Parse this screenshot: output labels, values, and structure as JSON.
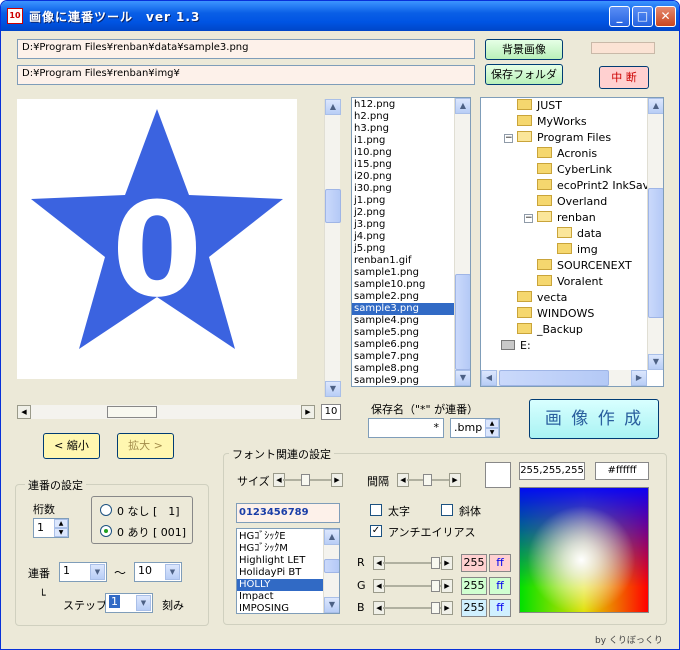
{
  "window": {
    "title": "画像に連番ツール　ver 1.3",
    "icon": "app-icon"
  },
  "paths": {
    "image_path": "D:¥Program Files¥renban¥data¥sample3.png",
    "save_folder": "D:¥Program Files¥renban¥img¥"
  },
  "buttons": {
    "bg_image": "背景画像",
    "save_folder": "保存フォルダ",
    "stop": "中 断",
    "zoom_out": "< 縮小",
    "zoom_in": "拡大 >",
    "create": "画 像 作 成"
  },
  "preview": {
    "digit": "0",
    "zoom_value": "10"
  },
  "file_list": {
    "items": [
      "h12.png",
      "h2.png",
      "h3.png",
      "i1.png",
      "i10.png",
      "i15.png",
      "i20.png",
      "i30.png",
      "j1.png",
      "j2.png",
      "j3.png",
      "j4.png",
      "j5.png",
      "renban1.gif",
      "sample1.png",
      "sample10.png",
      "sample2.png",
      "sample3.png",
      "sample4.png",
      "sample5.png",
      "sample6.png",
      "sample7.png",
      "sample8.png",
      "sample9.png"
    ],
    "selected": "sample3.png"
  },
  "tree": {
    "items": [
      {
        "label": "JUST",
        "level": 1
      },
      {
        "label": "MyWorks",
        "level": 1
      },
      {
        "label": "Program Files",
        "level": 1
      },
      {
        "label": "Acronis",
        "level": 2
      },
      {
        "label": "CyberLink",
        "level": 2
      },
      {
        "label": "ecoPrint2 InkSave",
        "level": 2
      },
      {
        "label": "Overland",
        "level": 2
      },
      {
        "label": "renban",
        "level": 2
      },
      {
        "label": "data",
        "level": 3
      },
      {
        "label": "img",
        "level": 3
      },
      {
        "label": "SOURCENEXT",
        "level": 2
      },
      {
        "label": "Voralent",
        "level": 2
      },
      {
        "label": "vecta",
        "level": 1
      },
      {
        "label": "WINDOWS",
        "level": 1
      },
      {
        "label": "_Backup",
        "level": 1
      },
      {
        "label": "E:",
        "level": 0
      }
    ]
  },
  "save_name": {
    "label": "保存名（\"*\" が連番）",
    "value": "*",
    "ext": ".bmp"
  },
  "serial": {
    "group_title": "連番の設定",
    "digits_label": "桁数",
    "digits_value": "1",
    "radio_none": "0 なし [　1]",
    "radio_pad": "0 あり [ 001]",
    "serial_label": "連番",
    "from_value": "1",
    "tilde": "〜",
    "to_value": "10",
    "step_prefix": "└",
    "step_label": "ステップ",
    "step_value": "1",
    "step_unit": "刻み"
  },
  "font": {
    "group_title": "フォント関連の設定",
    "size_label": "サイズ",
    "spacing_label": "間隔",
    "sample_text": "0123456789",
    "fonts": [
      "HGｺﾞｼｯｸE",
      "HGｺﾞｼｯｸM",
      "Highlight LET",
      "HolidayPi BT",
      "HOLLY",
      "Impact",
      "IMPOSING"
    ],
    "selected_font": "HOLLY",
    "bold_label": "太字",
    "italic_label": "斜体",
    "antialias_label": "アンチエイリアス",
    "r_label": "R",
    "g_label": "G",
    "b_label": "B",
    "r_value": "255",
    "g_value": "255",
    "b_value": "255",
    "r_hex": "ff",
    "g_hex": "ff",
    "b_hex": "ff",
    "rgb_text": "255,255,255",
    "hex_text": "#ffffff"
  },
  "footer": {
    "credit": "by くりぼっくり"
  },
  "colors": {
    "star": "#3b63e0",
    "title_bar": "#0054e3",
    "accent_cyan": "#a9f3f3"
  }
}
